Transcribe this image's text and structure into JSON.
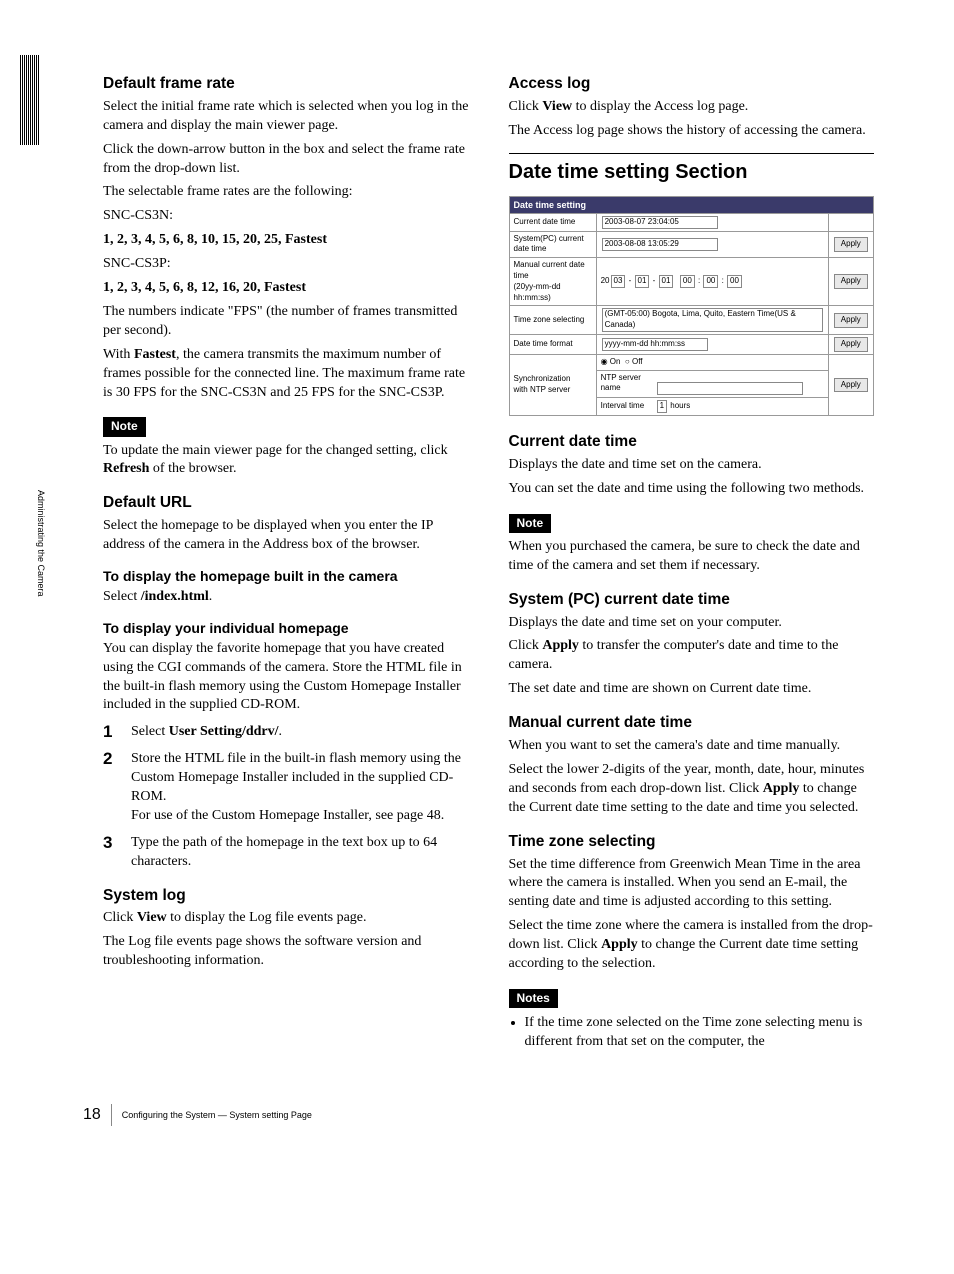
{
  "side": {
    "label": "Administrating the Camera"
  },
  "left": {
    "h3_1": "Default frame rate",
    "p1": "Select the initial frame rate which is selected when you log in the camera and display the main viewer page.",
    "p2": "Click the down-arrow button in the box and select the frame rate from the drop-down list.",
    "p3": "The selectable frame rates are the following:",
    "p4": "SNC-CS3N:",
    "p5": "1, 2, 3, 4, 5, 6, 8, 10, 15, 20, 25, Fastest",
    "p6": "SNC-CS3P:",
    "p7": "1, 2, 3, 4, 5, 6, 8, 12, 16, 20, Fastest",
    "p8": "The numbers indicate \"FPS\" (the number of frames transmitted per second).",
    "p9a": "With ",
    "p9b": "Fastest",
    "p9c": ", the camera transmits the maximum number of frames possible for the connected line.  The maximum frame rate is 30 FPS for the SNC-CS3N and 25 FPS for the SNC-CS3P.",
    "note1": "Note",
    "p10a": "To update the main viewer page for the changed setting, click ",
    "p10b": "Refresh",
    "p10c": " of the browser.",
    "h3_2": "Default URL",
    "p11": "Select the homepage to be displayed when you enter the IP address of the camera in the Address box of the browser.",
    "h4_1": "To display the homepage built in the camera",
    "p12a": "Select ",
    "p12b": "/index.html",
    "p12c": ".",
    "h4_2": "To display your individual homepage",
    "p13": "You can display the favorite homepage that you have created using the CGI commands of the camera. Store the HTML file in the built-in flash memory using the Custom Homepage Installer included in the supplied CD-ROM.",
    "step1a": "Select ",
    "step1b": "User Setting/ddrv/",
    "step1c": ".",
    "step2": "Store the HTML file in the built-in flash memory using the Custom Homepage Installer included in the supplied CD-ROM.",
    "step2b": "For use of the Custom Homepage Installer, see page 48.",
    "step3": "Type the path of the homepage in the text box up to 64 characters.",
    "h3_3": "System log",
    "p14a": "Click ",
    "p14b": "View",
    "p14c": " to display the Log file events page.",
    "p15": "The Log file events page shows the software version and troubleshooting information."
  },
  "right": {
    "h3_1": "Access log",
    "p1a": "Click ",
    "p1b": "View",
    "p1c": " to display the Access log page.",
    "p2": "The Access log page shows the history of accessing the camera.",
    "h2_1": "Date time setting Section",
    "fig": {
      "title": "Date time setting",
      "r1_label": "Current date time",
      "r1_value": "2003-08-07   23:04:05",
      "r2_label": "System(PC) current date time",
      "r2_value": "2003-08-08   13:05:29",
      "r3_label_a": "Manual current date time",
      "r3_label_b": "(20yy-mm-dd hh:mm:ss)",
      "r3_prefix": "20",
      "r3_a": "03",
      "r3_b": "01",
      "r3_c": "01",
      "r3_d": "00",
      "r3_e": "00",
      "r3_f": "00",
      "r4_label": "Time zone selecting",
      "r4_value": "(GMT-05:00) Bogota, Lima, Quito, Eastern Time(US & Canada)",
      "r5_label": "Date time format",
      "r5_value": "yyyy-mm-dd hh:mm:ss",
      "r6_label_a": "Synchronization",
      "r6_label_b": "with NTP server",
      "r6_on": "On",
      "r6_off": "Off",
      "r6_ntp": "NTP server name",
      "r6_int": "Interval time",
      "r6_int_v": "1",
      "r6_int_u": "hours",
      "apply": "Apply"
    },
    "h3_2": "Current date time",
    "p3": "Displays the date and time set on the camera.",
    "p4": "You can set the date and time using the following two methods.",
    "note1": "Note",
    "p5": "When you purchased the camera, be sure to check the date and time of the camera and set them if necessary.",
    "h3_3": "System (PC) current date time",
    "p6": "Displays the date and time set on your computer.",
    "p7a": "Click ",
    "p7b": "Apply",
    "p7c": " to transfer the computer's date and time to the camera.",
    "p8": "The set date and time are shown on Current date time.",
    "h3_4": "Manual current date time",
    "p9": "When you want to set the camera's date and time manually.",
    "p10a": "Select the lower 2-digits of the year, month, date, hour, minutes and seconds from each drop-down list.  Click ",
    "p10b": "Apply",
    "p10c": " to change the Current date time setting to the date and time you selected.",
    "h3_5": "Time zone selecting",
    "p11": "Set the time difference from Greenwich Mean Time in the area where the camera is installed. When you send an E-mail, the senting date and time is adjusted according to this setting.",
    "p12a": "Select the time zone where the camera is installed from the drop-down list.  Click ",
    "p12b": "Apply",
    "p12c": " to change the Current date time setting according to the selection.",
    "notes": "Notes",
    "bullet1": "If the time zone selected on the Time zone selecting menu is different from that set on the computer, the"
  },
  "footer": {
    "page": "18",
    "text": "Configuring the System — System setting Page"
  }
}
